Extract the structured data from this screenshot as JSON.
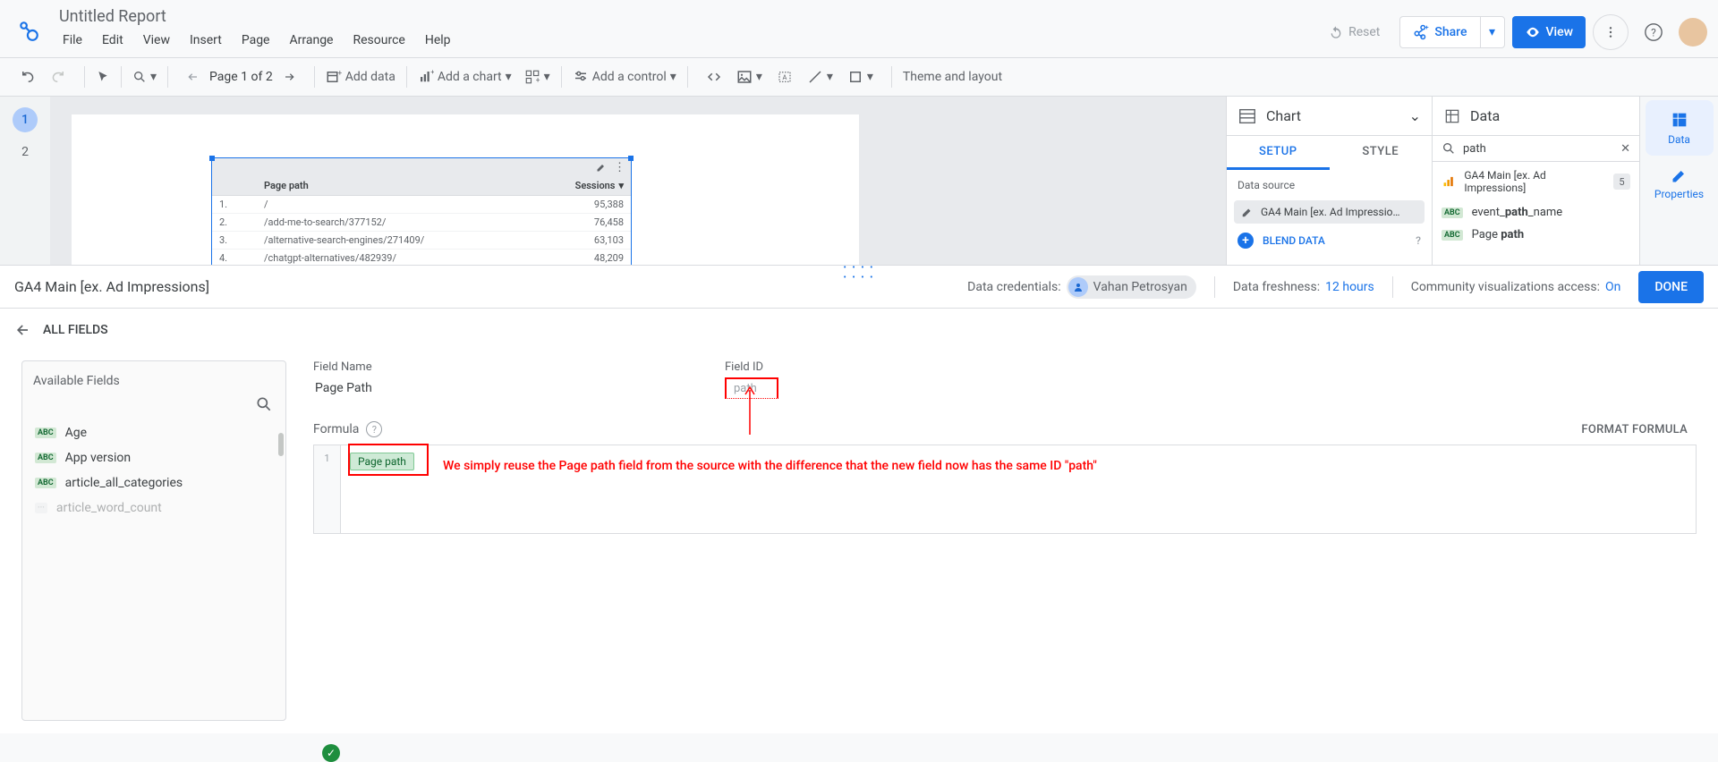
{
  "header": {
    "title": "Untitled Report",
    "menu": [
      "File",
      "Edit",
      "View",
      "Insert",
      "Page",
      "Arrange",
      "Resource",
      "Help"
    ],
    "reset": "Reset",
    "share": "Share",
    "view": "View"
  },
  "toolbar": {
    "pager": "Page 1 of 2",
    "add_data": "Add data",
    "add_chart": "Add a chart",
    "add_control": "Add a control",
    "theme": "Theme and layout"
  },
  "pages": {
    "list": [
      "1",
      "2"
    ],
    "active": 0
  },
  "chart_table": {
    "cols": [
      "",
      "Page path",
      "Sessions"
    ],
    "rows": [
      {
        "n": "1.",
        "path": "/",
        "sessions": "95,388"
      },
      {
        "n": "2.",
        "path": "/add-me-to-search/377152/",
        "sessions": "76,458"
      },
      {
        "n": "3.",
        "path": "/alternative-search-engines/271409/",
        "sessions": "63,103"
      },
      {
        "n": "4.",
        "path": "/chatgpt-alternatives/482939/",
        "sessions": "48,209"
      }
    ]
  },
  "chart_panel": {
    "title": "Chart",
    "tabs": [
      "SETUP",
      "STYLE"
    ],
    "ds_label": "Data source",
    "ds_name": "GA4 Main [ex. Ad Impressio…",
    "blend": "BLEND DATA"
  },
  "data_panel": {
    "title": "Data",
    "search_value": "path",
    "ds_name": "GA4 Main [ex. Ad Impressions]",
    "ds_count": "5",
    "fields": [
      {
        "pre": "event_",
        "bold": "path",
        "post": "_name"
      },
      {
        "pre": "Page ",
        "bold": "path",
        "post": ""
      }
    ]
  },
  "rail": {
    "data": "Data",
    "props": "Properties"
  },
  "editor": {
    "ds_title": "GA4 Main [ex. Ad Impressions]",
    "cred_label": "Data credentials:",
    "cred_user": "Vahan Petrosyan",
    "fresh_label": "Data freshness:",
    "fresh_val": "12 hours",
    "vis_label": "Community visualizations access:",
    "vis_val": "On",
    "done": "DONE",
    "all_fields": "ALL FIELDS",
    "av_title": "Available Fields",
    "av_list": [
      "Age",
      "App version",
      "article_all_categories",
      "article_word_count"
    ],
    "fn_label": "Field Name",
    "fn_value": "Page Path",
    "fid_label": "Field ID",
    "fid_value": "path",
    "formula_label": "Formula",
    "format_link": "FORMAT FORMULA",
    "formula_chip": "Page path",
    "annotation": "We simply reuse the Page path field from the source with the difference that the new field now has the same ID \"path\""
  }
}
